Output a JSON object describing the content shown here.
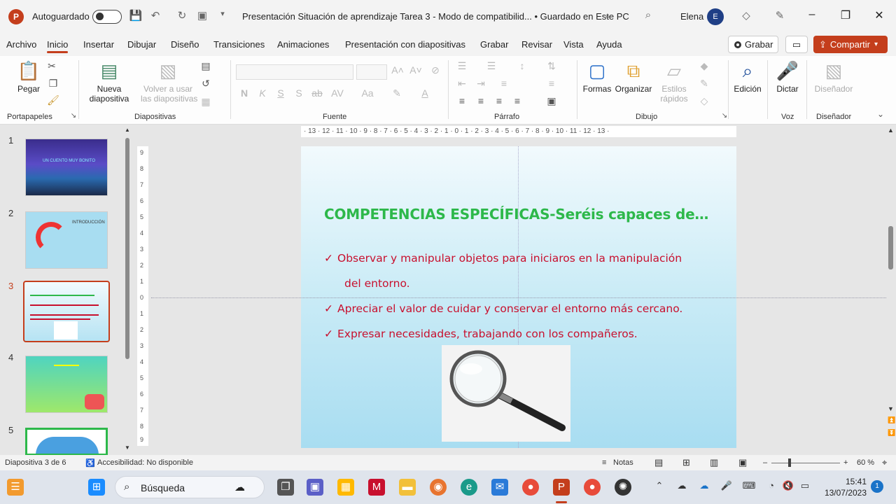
{
  "titlebar": {
    "autosave_label": "Autoguardado",
    "document_title": "Presentación Situación de aprendizaje Tarea 3  -  Modo de compatibilid...  •  Guardado en Este PC",
    "user_name": "Elena",
    "user_initial": "E"
  },
  "menu": {
    "items": [
      "Archivo",
      "Inicio",
      "Insertar",
      "Dibujar",
      "Diseño",
      "Transiciones",
      "Animaciones",
      "Presentación con diapositivas",
      "Grabar",
      "Revisar",
      "Vista",
      "Ayuda"
    ],
    "active": "Inicio",
    "record_button": "Grabar",
    "share_button": "Compartir"
  },
  "ribbon": {
    "groups": {
      "clipboard": "Portapapeles",
      "slides": "Diapositivas",
      "font": "Fuente",
      "paragraph": "Párrafo",
      "drawing": "Dibujo",
      "voice": "Voz",
      "designer": "Diseñador"
    },
    "paste": "Pegar",
    "new_slide_line1": "Nueva",
    "new_slide_line2": "diapositiva",
    "reuse_line1": "Volver a usar",
    "reuse_line2": "las diapositivas",
    "shapes": "Formas",
    "arrange": "Organizar",
    "quick_styles_line1": "Estilos",
    "quick_styles_line2": "rápidos",
    "editing": "Edición",
    "dictate": "Dictar",
    "designer_button": "Diseñador"
  },
  "thumbnails": {
    "numbers": [
      "1",
      "2",
      "3",
      "4",
      "5"
    ],
    "active_index": 3,
    "slide1_title": "UN CUENTO MUY BONITO",
    "slide2_title": "INTRODUCCIÓN"
  },
  "slide": {
    "title": "COMPETENCIAS ESPECÍFICAS-Seréis capaces de…",
    "bullets": [
      "Observar y manipular objetos para iniciaros en la  manipulación",
      "del entorno.",
      "Apreciar el valor de cuidar y conservar el entorno más cercano.",
      "Expresar necesidades, trabajando con los compañeros."
    ],
    "checkmark": "✓"
  },
  "ruler": {
    "horizontal": "· 13 · 12 · 11 · 10 · 9 · 8 · 7 · 6 · 5 · 4 · 3 · 2 · 1 · 0 · 1 · 2 · 3 · 4 · 5 · 6 · 7 · 8 · 9 · 10 · 11 · 12 · 13 ·",
    "vertical": [
      "9",
      "8",
      "7",
      "6",
      "5",
      "4",
      "3",
      "2",
      "1",
      "0",
      "1",
      "2",
      "3",
      "4",
      "5",
      "6",
      "7",
      "8",
      "9"
    ]
  },
  "status": {
    "slide_counter": "Diapositiva 3 de 6",
    "accessibility": "Accesibilidad: No disponible",
    "notes": "Notas",
    "zoom": "60 %"
  },
  "taskbar": {
    "search_label": "Búsqueda",
    "time": "15:41",
    "date": "13/07/2023",
    "notification_count": "1"
  },
  "colors": {
    "accent": "#c43e1c",
    "slide_title": "#2db84a",
    "slide_text": "#c8102e"
  }
}
